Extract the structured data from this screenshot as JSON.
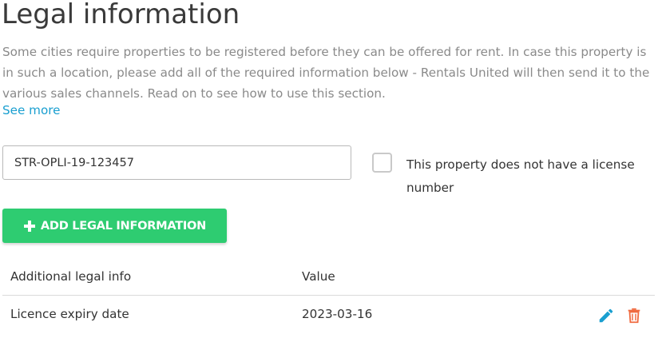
{
  "page": {
    "title": "Legal information",
    "description": "Some cities require properties to be registered before they can be offered for rent. In case this property is in such a location, please add all of the required information below - Rentals United will then send it to the various sales channels. Read on to see how to use this section.",
    "see_more_label": "See more"
  },
  "license": {
    "value": "STR-OPLI-19-123457",
    "no_license_label": "This property does not have a license number",
    "no_license_checked": false
  },
  "add_button": {
    "label": "ADD LEGAL INFORMATION",
    "icon": "plus-icon",
    "color": "#2ecc71"
  },
  "table": {
    "headers": {
      "key": "Additional legal info",
      "value": "Value"
    },
    "rows": [
      {
        "key": "Licence expiry date",
        "value": "2023-03-16",
        "actions": [
          "edit-icon",
          "delete-icon"
        ]
      }
    ]
  },
  "colors": {
    "link": "#1a9fd0",
    "edit_icon": "#1a9fd0",
    "delete_icon": "#f06b40",
    "muted_text": "#8a8a8a"
  }
}
